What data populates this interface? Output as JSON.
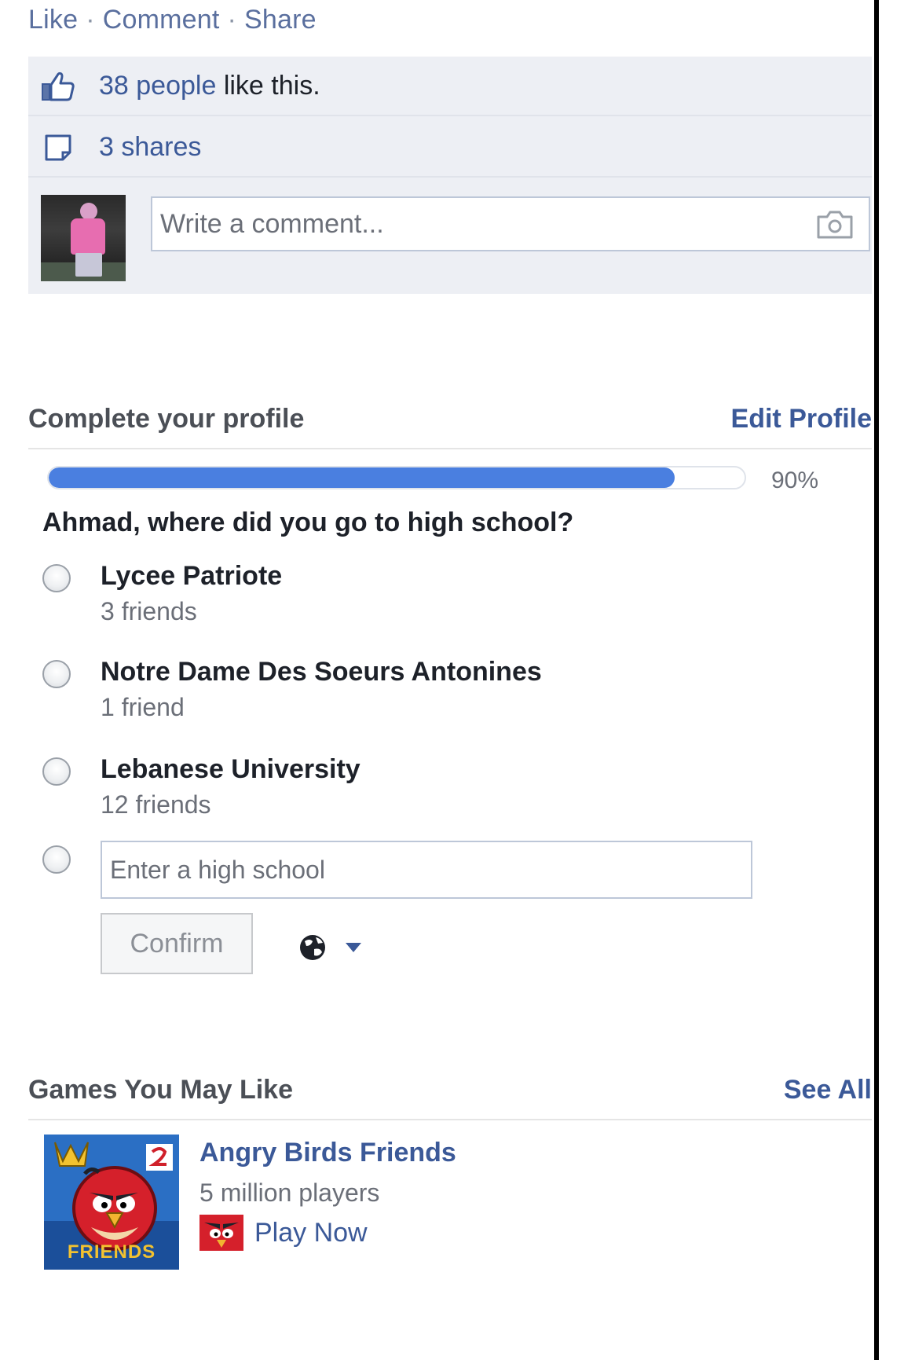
{
  "post_actions": {
    "like": "Like",
    "comment": "Comment",
    "share": "Share",
    "separator": "·"
  },
  "feedback": {
    "likes_link": "38 people",
    "likes_suffix": " like this.",
    "shares": "3 shares",
    "comment_placeholder": "Write a comment..."
  },
  "profile_completion": {
    "title": "Complete your profile",
    "edit_label": "Edit Profile",
    "progress": 0.9,
    "progress_label": "90%",
    "question": "Ahmad, where did you go to high school?",
    "options": [
      {
        "name": "Lycee Patriote",
        "friends": "3 friends"
      },
      {
        "name": "Notre Dame Des Soeurs Antonines",
        "friends": "1 friend"
      },
      {
        "name": "Lebanese University",
        "friends": "12 friends"
      }
    ],
    "custom_placeholder": "Enter a high school",
    "confirm_label": "Confirm"
  },
  "games": {
    "title": "Games You May Like",
    "see_all": "See All",
    "items": [
      {
        "name": "Angry Birds Friends",
        "players": "5 million players",
        "play_label": "Play Now",
        "icon": "angry-birds-friends-icon",
        "icon_text": "FRIENDS"
      }
    ]
  },
  "colors": {
    "link": "#3b5998",
    "progress_fill": "#4a7fe0",
    "feedback_bg": "#edeff4"
  }
}
